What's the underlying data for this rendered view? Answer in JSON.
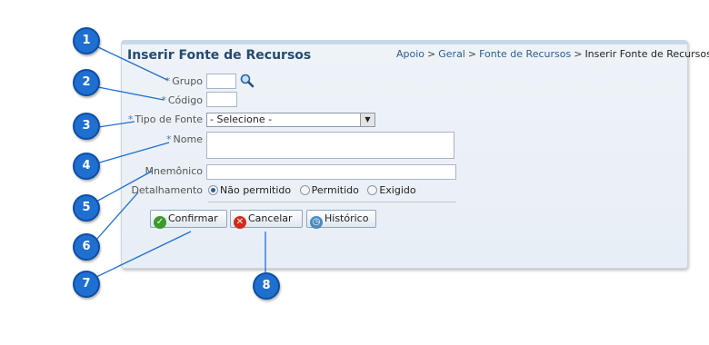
{
  "form": {
    "title": "Inserir Fonte de Recursos",
    "breadcrumb": {
      "item1": "Apoio",
      "sep1": ">",
      "item2": "Geral",
      "sep2": ">",
      "item3": "Fonte de Recursos",
      "sep3": ">",
      "current": "Inserir Fonte de Recursos"
    },
    "required_marker": "*",
    "fields": {
      "grupo": "Grupo",
      "codigo": "Código",
      "tipo_fonte": "Tipo de Fonte",
      "nome": "Nome",
      "mnemonico": "Mnemônico",
      "detalhamento": "Detalhamento"
    },
    "tipo_fonte_selected": "- Selecione -",
    "detalhamento_options": [
      "Não permitido",
      "Permitido",
      "Exigido"
    ],
    "detalhamento_selected": "Não permitido"
  },
  "buttons": {
    "confirmar": "Confirmar",
    "cancelar": "Cancelar",
    "historico": "Histórico"
  },
  "callouts": [
    "1",
    "2",
    "3",
    "4",
    "5",
    "6",
    "7",
    "8"
  ],
  "colors": {
    "callout": "#1f6fd1",
    "title": "#254a73",
    "confirm_icon": "#3a9a2a",
    "cancel_icon": "#d42a1c",
    "history_icon": "#4a8bc0"
  }
}
